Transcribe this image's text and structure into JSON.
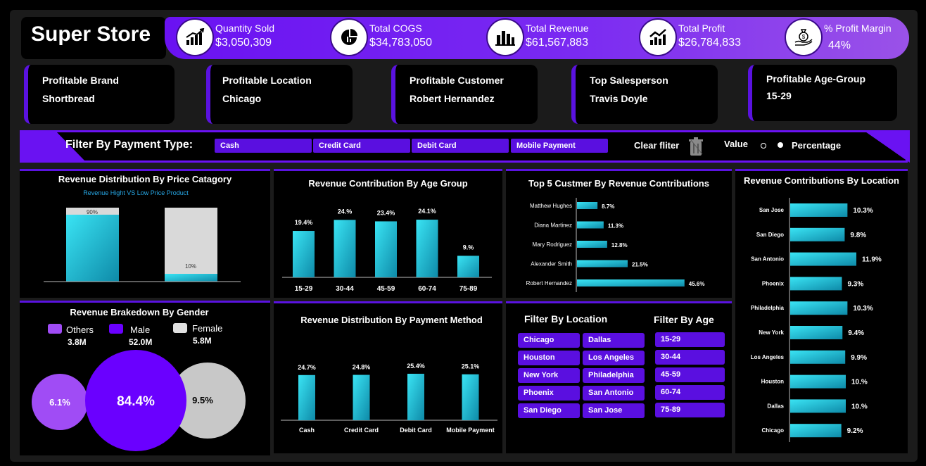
{
  "app_title": "Super Store",
  "kpis": [
    {
      "label": "Quantity Sold",
      "value": "$3,050,309",
      "icon": "bar-growth-icon"
    },
    {
      "label": "Total COGS",
      "value": "$34,783,050",
      "icon": "pie-chart-icon"
    },
    {
      "label": "Total Revenue",
      "value": "$61,567,883",
      "icon": "bar-chart-icon"
    },
    {
      "label": "Total Profit",
      "value": "$26,784,833",
      "icon": "trend-up-icon"
    },
    {
      "label": "% Profit Margin",
      "value": "44%",
      "icon": "money-bag-hand-icon"
    }
  ],
  "cards": [
    {
      "label": "Profitable Brand",
      "value": "Shortbread"
    },
    {
      "label": "Profitable Location",
      "value": "Chicago"
    },
    {
      "label": "Profitable Customer",
      "value": "Robert Hernandez"
    },
    {
      "label": "Top Salesperson",
      "value": "Travis Doyle"
    },
    {
      "label": "Profitable Age-Group",
      "value": "15-29"
    }
  ],
  "payment_filter": {
    "label": "Filter By Payment Type:",
    "options": [
      "Cash",
      "Credit Card",
      "Debit Card",
      "Mobile Payment"
    ],
    "clear_label": "Clear fliter",
    "value_label": "Value",
    "percentage_label": "Percentage",
    "selected": "Percentage"
  },
  "location_filter": {
    "label": "Filter By Location",
    "options": [
      "Chicago",
      "Dallas",
      "Houston",
      "Los Angeles",
      "New York",
      "Philadelphia",
      "Phoenix",
      "San Antonio",
      "San Diego",
      "San Jose"
    ]
  },
  "age_filter": {
    "label": "Filter By Age",
    "options": [
      "15-29",
      "30-44",
      "45-59",
      "60-74",
      "75-89"
    ]
  },
  "colors": {
    "accent": "#6a12f2",
    "bar": "#1ec8e0",
    "gray": "#d9d9d9"
  },
  "chart_data": [
    {
      "type": "bar",
      "title": "Revenue Distribution By Price Catagory",
      "subtitle": "Revenue Hight VS Low Price Product",
      "series": [
        {
          "values": [
            90,
            10
          ]
        },
        {
          "values": [
            10,
            90
          ]
        }
      ],
      "labels": [
        "90%",
        "10%"
      ]
    },
    {
      "type": "bar",
      "title": "Revenue Contribution By Age Group",
      "categories": [
        "15-29",
        "30-44",
        "45-59",
        "60-74",
        "75-89"
      ],
      "values": [
        19.4,
        24.0,
        23.4,
        24.1,
        9.0
      ],
      "labels": [
        "19.4%",
        "24.%",
        "23.4%",
        "24.1%",
        "9.%"
      ]
    },
    {
      "type": "bar",
      "title": "Top 5 Custmer By Revenue Contributions",
      "categories": [
        "Matthew Hughes",
        "Diana Martinez",
        "Mary Rodriguez",
        "Alexander Smith",
        "Robert Hernandez"
      ],
      "values": [
        8.7,
        11.3,
        12.8,
        21.5,
        45.6
      ],
      "labels": [
        "8.7%",
        "11.3%",
        "12.8%",
        "21.5%",
        "45.6%"
      ]
    },
    {
      "type": "bar",
      "title": "Revenue Contributions By Location",
      "categories": [
        "San Jose",
        "San Diego",
        "San Antonio",
        "Phoenix",
        "Philadelphia",
        "New York",
        "Los Angeles",
        "Houston",
        "Dallas",
        "Chicago"
      ],
      "values": [
        10.3,
        9.8,
        11.9,
        9.3,
        10.3,
        9.4,
        9.9,
        10.0,
        10.0,
        9.2
      ],
      "labels": [
        "10.3%",
        "9.8%",
        "11.9%",
        "9.3%",
        "10.3%",
        "9.4%",
        "9.9%",
        "10.%",
        "10.%",
        "9.2%"
      ]
    },
    {
      "type": "bar",
      "title": "Revenue Distribution By Payment Method",
      "categories": [
        "Cash",
        "Credit Card",
        "Debit Card",
        "Mobile Payment"
      ],
      "values": [
        24.7,
        24.8,
        25.4,
        25.1
      ],
      "labels": [
        "24.7%",
        "24.8%",
        "25.4%",
        "25.1%"
      ]
    },
    {
      "type": "pie",
      "title": "Revenue Brakedown By Gender",
      "categories": [
        "Others",
        "Male",
        "Female"
      ],
      "values": [
        6.1,
        84.4,
        9.5
      ],
      "labels": [
        "6.1%",
        "84.4%",
        "9.5%"
      ],
      "totals": [
        "3.8M",
        "52.0M",
        "5.8M"
      ],
      "colors": [
        "#a04cf5",
        "#6a00ff",
        "#c8c8c8"
      ]
    }
  ]
}
